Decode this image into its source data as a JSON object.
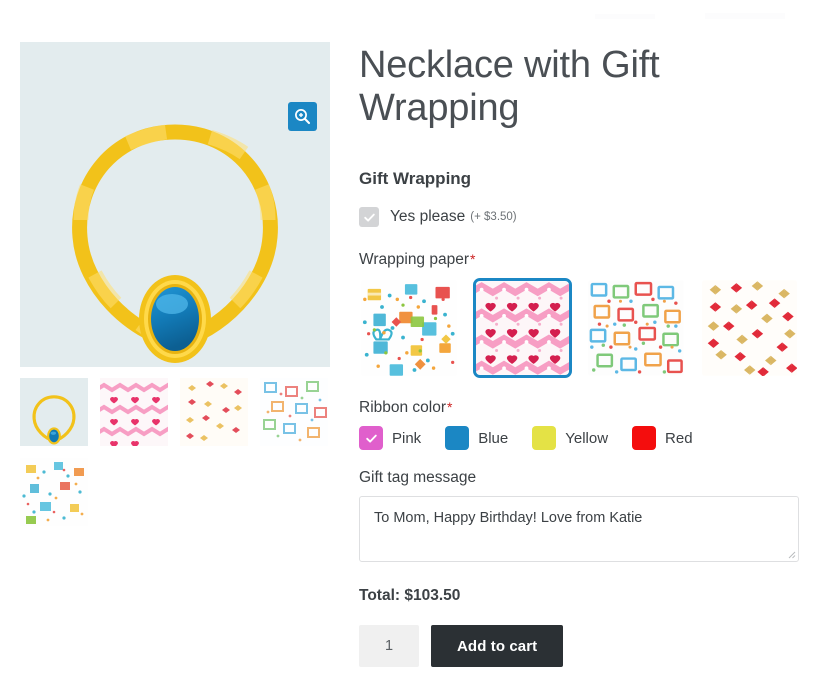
{
  "product": {
    "title": "Necklace with Gift Wrapping",
    "main_image_alt": "gold-necklace-with-blue-gem",
    "zoom_icon": "magnify-plus-icon"
  },
  "gallery": {
    "thumbnails": [
      {
        "name": "thumb-necklace",
        "pattern": "necklace"
      },
      {
        "name": "thumb-pink-hearts",
        "pattern": "pink-hearts"
      },
      {
        "name": "thumb-gold-bows",
        "pattern": "gold-bows"
      },
      {
        "name": "thumb-blue-gifts",
        "pattern": "blue-gifts"
      },
      {
        "name": "thumb-confetti-gifts",
        "pattern": "confetti-gifts"
      }
    ]
  },
  "gift_wrapping": {
    "heading": "Gift Wrapping",
    "checkbox": {
      "label": "Yes please",
      "price_note": "(+ $3.50)",
      "checked": true,
      "icon": "check-icon"
    },
    "wrapping_paper": {
      "label": "Wrapping paper",
      "required_marker": "*",
      "selected_index": 1,
      "options": [
        {
          "name": "confetti-gifts",
          "label": "Confetti gifts"
        },
        {
          "name": "pink-hearts",
          "label": "Pink hearts"
        },
        {
          "name": "colorful-gifts",
          "label": "Colorful gifts"
        },
        {
          "name": "red-gold-bows",
          "label": "Red and gold bows"
        }
      ]
    },
    "ribbon_color": {
      "label": "Ribbon color",
      "required_marker": "*",
      "selected_index": 0,
      "options": [
        {
          "label": "Pink",
          "color": "#e05fcc"
        },
        {
          "label": "Blue",
          "color": "#1b87c4"
        },
        {
          "label": "Yellow",
          "color": "#e4e245"
        },
        {
          "label": "Red",
          "color": "#f40d0d"
        }
      ]
    },
    "gift_tag": {
      "label": "Gift tag message",
      "value": "To Mom, Happy Birthday! Love from Katie",
      "placeholder": ""
    }
  },
  "purchase": {
    "total_label": "Total: $103.50",
    "quantity": "1",
    "add_to_cart_label": "Add to cart"
  },
  "colors": {
    "accent_blue": "#1b87c4",
    "dark_button": "#2b3034",
    "image_bg": "#e3ecee",
    "required_red": "#cc2222"
  }
}
